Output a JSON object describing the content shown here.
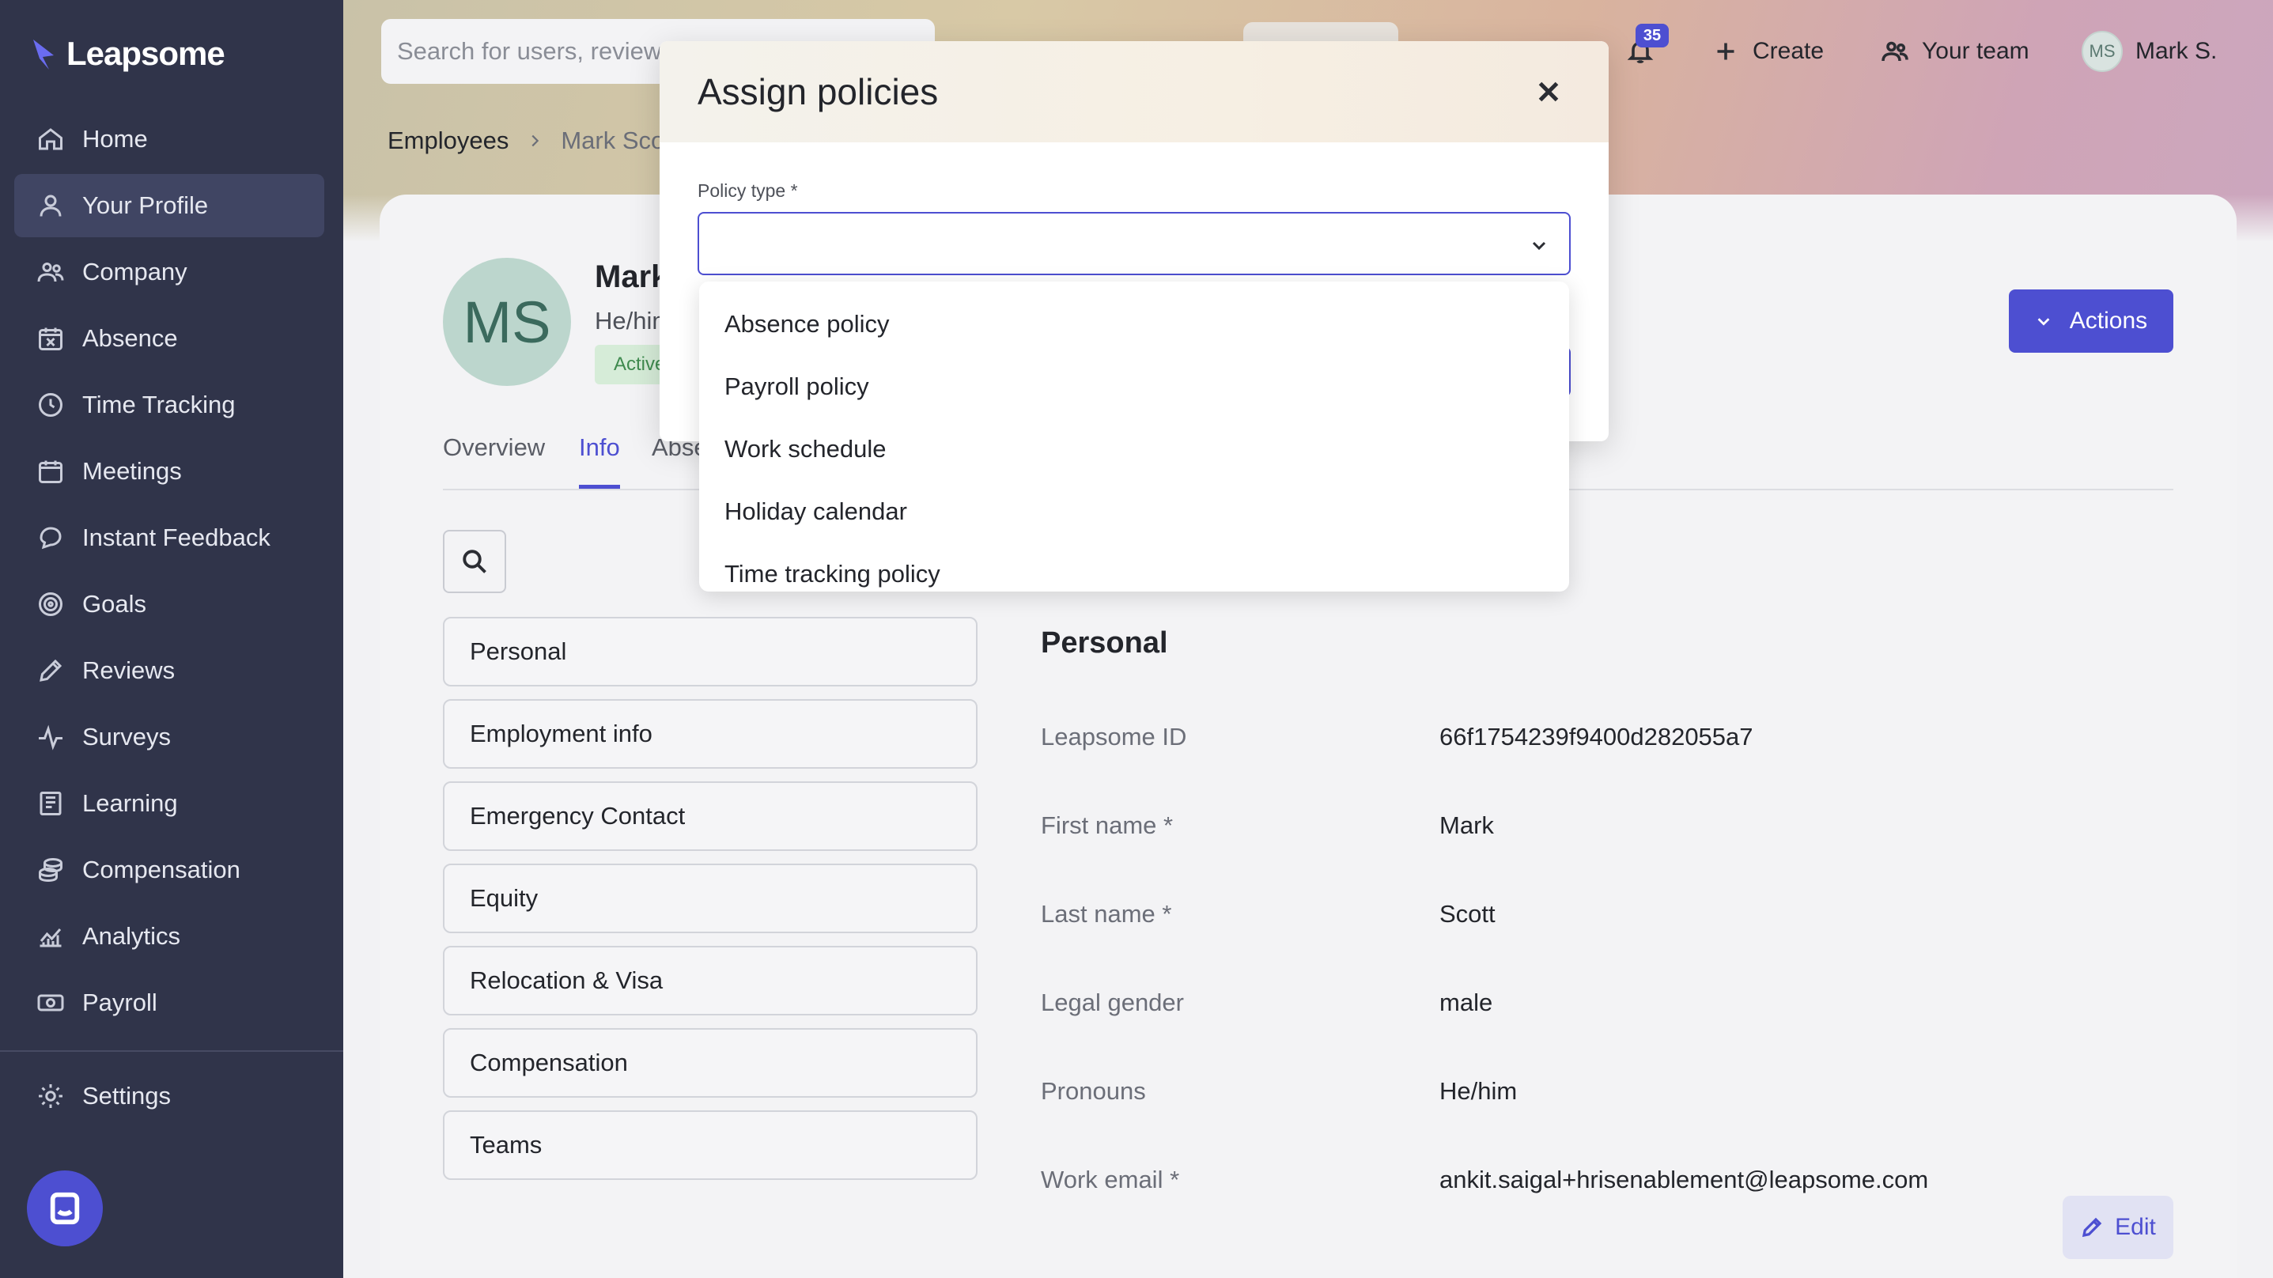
{
  "brand": {
    "name": "Leapsome",
    "icon": "leapsome-logo-icon"
  },
  "sidebar": {
    "items": [
      {
        "label": "Home",
        "icon": "home-icon",
        "active": false
      },
      {
        "label": "Your Profile",
        "icon": "user-icon",
        "active": true
      },
      {
        "label": "Company",
        "icon": "people-icon",
        "active": false
      },
      {
        "label": "Absence",
        "icon": "calendar-x-icon",
        "active": false
      },
      {
        "label": "Time Tracking",
        "icon": "clock-icon",
        "active": false
      },
      {
        "label": "Meetings",
        "icon": "calendar-icon",
        "active": false
      },
      {
        "label": "Instant Feedback",
        "icon": "chat-bubble-icon",
        "active": false
      },
      {
        "label": "Goals",
        "icon": "target-icon",
        "active": false
      },
      {
        "label": "Reviews",
        "icon": "pencil-icon",
        "active": false
      },
      {
        "label": "Surveys",
        "icon": "pulse-icon",
        "active": false
      },
      {
        "label": "Learning",
        "icon": "book-icon",
        "active": false
      },
      {
        "label": "Compensation",
        "icon": "coins-icon",
        "active": false
      },
      {
        "label": "Analytics",
        "icon": "chart-icon",
        "active": false
      },
      {
        "label": "Payroll",
        "icon": "banknote-icon",
        "active": false
      }
    ],
    "settings": {
      "label": "Settings",
      "icon": "gear-icon"
    }
  },
  "topbar": {
    "search_placeholder": "Search for users, reviews",
    "notifications_count": "35",
    "create_label": "Create",
    "team_label": "Your team",
    "user_initials": "MS",
    "user_name": "Mark S."
  },
  "breadcrumb": {
    "parent": "Employees",
    "current": "Mark Scott"
  },
  "profile": {
    "initials": "MS",
    "name": "Mark",
    "pronouns": "He/him",
    "status": "Active",
    "actions_label": "Actions"
  },
  "tabs": [
    {
      "label": "Overview",
      "active": false
    },
    {
      "label": "Info",
      "active": true
    },
    {
      "label": "Absence",
      "active": false
    }
  ],
  "sections": [
    "Personal",
    "Employment info",
    "Emergency Contact",
    "Equity",
    "Relocation & Visa",
    "Compensation",
    "Teams"
  ],
  "details": {
    "title": "Personal",
    "rows": [
      {
        "label": "Leapsome ID",
        "value": "66f1754239f9400d282055a7"
      },
      {
        "label": "First name *",
        "value": "Mark"
      },
      {
        "label": "Last name *",
        "value": "Scott"
      },
      {
        "label": "Legal gender",
        "value": "male"
      },
      {
        "label": "Pronouns",
        "value": "He/him"
      },
      {
        "label": "Work email *",
        "value": "ankit.saigal+hrisenablement@leapsome.com"
      }
    ],
    "edit_label": "Edit"
  },
  "modal": {
    "title": "Assign policies",
    "policy_type_label": "Policy type *",
    "selected_value": "",
    "options": [
      "Absence policy",
      "Payroll policy",
      "Work schedule",
      "Holiday calendar",
      "Time tracking policy"
    ]
  },
  "colors": {
    "sidebar": "#30344a",
    "accent": "#4d4fd1",
    "active_status": "#3e8a4e"
  }
}
